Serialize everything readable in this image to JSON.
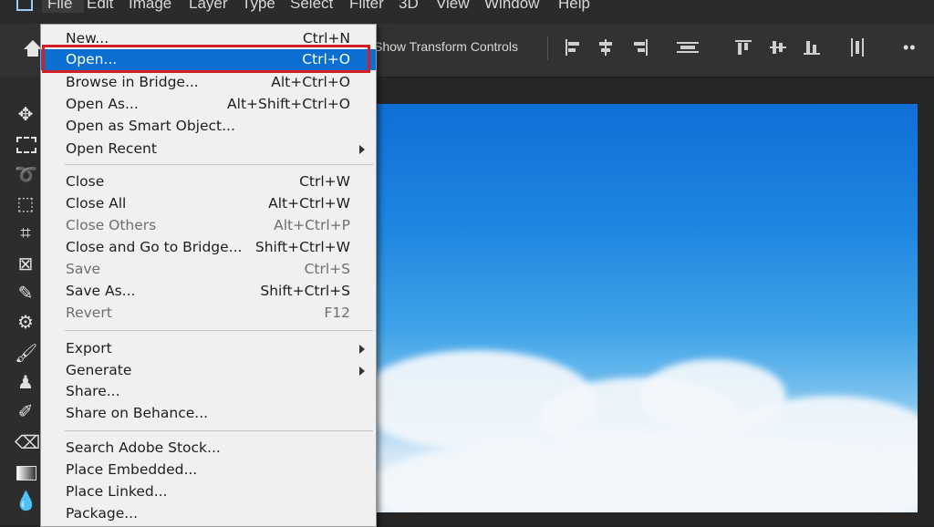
{
  "menubar": {
    "items": [
      "File",
      "Edit",
      "Image",
      "Layer",
      "Type",
      "Select",
      "Filter",
      "3D",
      "View",
      "Window",
      "Help"
    ]
  },
  "options": {
    "show_transform": "Show Transform Controls"
  },
  "file_menu": {
    "items": [
      {
        "label": "New...",
        "shortcut": "Ctrl+N"
      },
      {
        "label": "Open...",
        "shortcut": "Ctrl+O",
        "selected": true
      },
      {
        "label": "Browse in Bridge...",
        "shortcut": "Alt+Ctrl+O"
      },
      {
        "label": "Open As...",
        "shortcut": "Alt+Shift+Ctrl+O"
      },
      {
        "label": "Open as Smart Object...",
        "shortcut": ""
      },
      {
        "label": "Open Recent",
        "shortcut": "",
        "submenu": true
      },
      {
        "label": "Close",
        "shortcut": "Ctrl+W"
      },
      {
        "label": "Close All",
        "shortcut": "Alt+Ctrl+W"
      },
      {
        "label": "Close Others",
        "shortcut": "Alt+Ctrl+P",
        "disabled": true
      },
      {
        "label": "Close and Go to Bridge...",
        "shortcut": "Shift+Ctrl+W"
      },
      {
        "label": "Save",
        "shortcut": "Ctrl+S",
        "disabled": true
      },
      {
        "label": "Save As...",
        "shortcut": "Shift+Ctrl+S"
      },
      {
        "label": "Revert",
        "shortcut": "F12",
        "disabled": true
      },
      {
        "label": "Export",
        "shortcut": "",
        "submenu": true
      },
      {
        "label": "Generate",
        "shortcut": "",
        "submenu": true
      },
      {
        "label": "Share...",
        "shortcut": ""
      },
      {
        "label": "Share on Behance...",
        "shortcut": ""
      },
      {
        "label": "Search Adobe Stock...",
        "shortcut": ""
      },
      {
        "label": "Place Embedded...",
        "shortcut": ""
      },
      {
        "label": "Place Linked...",
        "shortcut": ""
      },
      {
        "label": "Package...",
        "shortcut": ""
      }
    ]
  },
  "colors": {
    "selected_bg": "#0b6fd2",
    "highlight_border": "#d21f24"
  }
}
